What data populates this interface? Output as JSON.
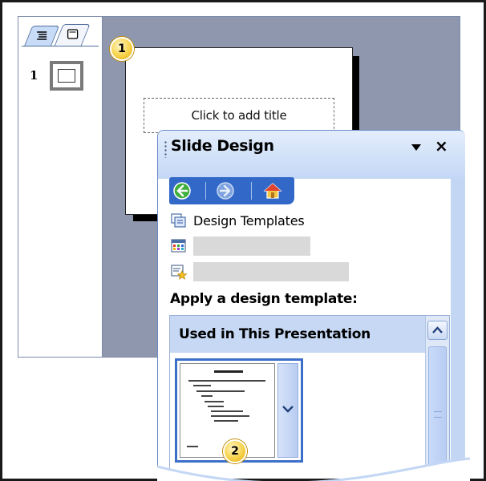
{
  "slides_pane": {
    "tabs": [
      {
        "name": "outline-tab-icon"
      },
      {
        "name": "slides-tab-icon"
      }
    ],
    "slide_number": "1"
  },
  "slide": {
    "title_placeholder": "Click to add title"
  },
  "callouts": {
    "first": "1",
    "second": "2"
  },
  "task_pane": {
    "title": "Slide Design",
    "dropdown_icon": "triangle-down-icon",
    "close_label": "×",
    "nav": {
      "back_icon": "back-arrow-icon",
      "forward_icon": "forward-arrow-icon",
      "home_icon": "home-icon"
    },
    "links": [
      {
        "icon": "design-templates-icon",
        "label": "Design Templates"
      },
      {
        "icon": "color-schemes-icon",
        "label": ""
      },
      {
        "icon": "animation-schemes-icon",
        "label": ""
      }
    ],
    "apply_label": "Apply a design template:",
    "gallery": {
      "section_header": "Used in This Presentation"
    }
  },
  "colors": {
    "workspace": "#8e97ad",
    "nav_bar": "#3268c7",
    "header_gradient_top": "#e4eefc",
    "header_gradient_bottom": "#c3d7f5",
    "section_header": "#c6d8f4",
    "callout": "#f7d24a"
  }
}
